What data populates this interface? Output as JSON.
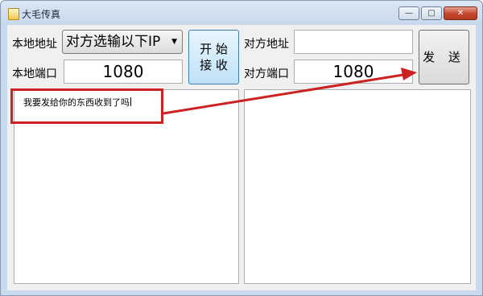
{
  "window": {
    "title": "大毛传真",
    "controls": [
      "minimize-icon",
      "maximize-icon",
      "close-icon"
    ]
  },
  "left": {
    "address_label": "本地地址",
    "address_select_value": "对方选输以下IP",
    "port_label": "本地端口",
    "port_value": "1080"
  },
  "buttons": {
    "receive_line1": "开 始",
    "receive_line2": "接 收",
    "send_label": "发 送"
  },
  "right": {
    "address_label": "对方地址",
    "address_value": "",
    "port_label": "对方端口",
    "port_value": "1080"
  },
  "send_area": {
    "text": "我要发给你的东西收到了吗"
  },
  "receive_area": {
    "text": ""
  },
  "annotation": {
    "color": "#cc2222"
  }
}
